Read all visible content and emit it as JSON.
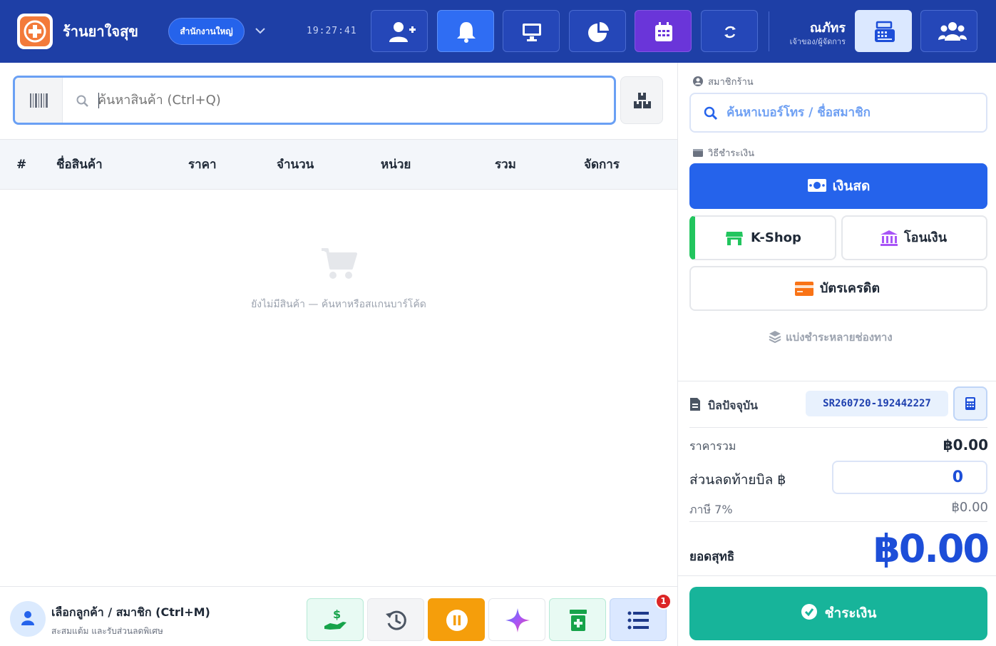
{
  "header": {
    "store_name": "ร้านยาใจสุข",
    "branch": "สำนักงานใหญ่",
    "clock": "19:27:41",
    "user_name": "ณภัทร",
    "user_role": "เจ้าของ/ผู้จัดการ",
    "icons": [
      "user-plus-icon",
      "bell-icon",
      "monitor-icon",
      "pie-chart-icon",
      "calendar-icon",
      "refresh-icon",
      "cash-register-icon",
      "users-icon"
    ]
  },
  "search": {
    "placeholder": "ค้นหาสินค้า (Ctrl+Q)"
  },
  "table": {
    "columns": [
      "#",
      "ชื่อสินค้า",
      "ราคา",
      "จำนวน",
      "หน่วย",
      "รวม",
      "จัดการ"
    ],
    "empty_text": "ยังไม่มีสินค้า — ค้นหาหรือสแกนบาร์โค้ด"
  },
  "customer": {
    "title": "เลือกลูกค้า / สมาชิก (Ctrl+M)",
    "subtitle": "สะสมแต้ม และรับส่วนลดพิเศษ"
  },
  "bottom_actions": {
    "badge_count": "1",
    "icons": [
      "hand-money-icon",
      "history-icon",
      "pause-icon",
      "sparkle-icon",
      "medicine-icon",
      "list-icon"
    ]
  },
  "sidebar": {
    "member_label": "สมาชิกร้าน",
    "member_placeholder": "ค้นหาเบอร์โทร / ชื่อสมาชิก",
    "payment_label": "วิธีชำระเงิน",
    "pay_cash": "เงินสด",
    "pay_kshop": "K-Shop",
    "pay_transfer": "โอนเงิน",
    "pay_credit": "บัตรเครดิต",
    "split_payment": "แบ่งชำระหลายช่องทาง",
    "bill_label": "บิลปัจจุบัน",
    "bill_no": "SR260720-192442227",
    "subtotal_label": "ราคารวม",
    "subtotal_value": "฿0.00",
    "discount_label": "ส่วนลดท้ายบิล ฿",
    "discount_value": "0",
    "tax_label": "ภาษี 7%",
    "tax_value": "฿0.00",
    "net_label": "ยอดสุทธิ",
    "net_value": "฿0.00",
    "checkout": "ชำระเงิน"
  },
  "colors": {
    "header_bg": "#1e3fa6",
    "primary": "#2563eb",
    "checkout": "#17b49a",
    "pause": "#f59e0b",
    "badge": "#dc2626"
  }
}
